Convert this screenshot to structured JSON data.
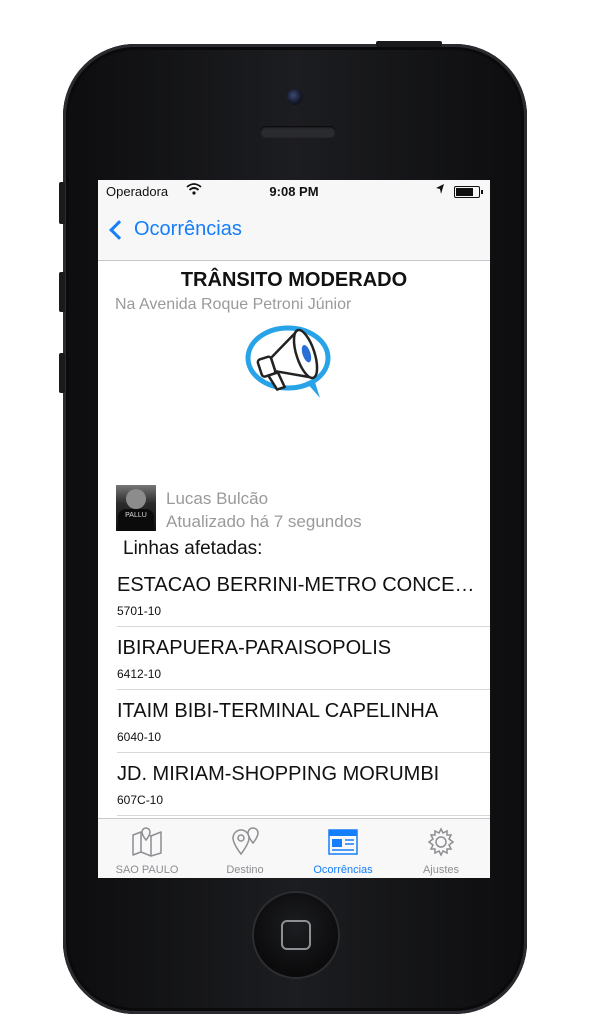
{
  "status_bar": {
    "carrier": "Operadora",
    "time": "9:08 PM",
    "battery_level": 0.85
  },
  "nav": {
    "back_label": "Ocorrências"
  },
  "incident": {
    "title": "TRÂNSITO MODERADO",
    "location": "Na Avenida Roque Petroni Júnior",
    "icon": "megaphone-icon"
  },
  "reporter": {
    "name": "Lucas Bulcão",
    "updated": "Atualizado há 7 segundos",
    "avatar_shirt_text": "PALLU"
  },
  "lines_label": "Linhas afetadas:",
  "lines": [
    {
      "name": "ESTACAO BERRINI-METRO CONCEIÇÃO",
      "code": "5701-10"
    },
    {
      "name": "IBIRAPUERA-PARAISOPOLIS",
      "code": "6412-10"
    },
    {
      "name": "ITAIM BIBI-TERMINAL CAPELINHA",
      "code": "6040-10"
    },
    {
      "name": "JD. MIRIAM-SHOPPING MORUMBI",
      "code": "607C-10"
    }
  ],
  "tabs": [
    {
      "label": "SAO PAULO",
      "icon": "map-icon"
    },
    {
      "label": "Destino",
      "icon": "location-pins-icon"
    },
    {
      "label": "Ocorrências",
      "icon": "newspaper-icon"
    },
    {
      "label": "Ajustes",
      "icon": "gear-icon"
    }
  ],
  "colors": {
    "accent": "#157efb",
    "inactive": "#8e8e93",
    "megaphone_ring": "#29a3e8"
  }
}
